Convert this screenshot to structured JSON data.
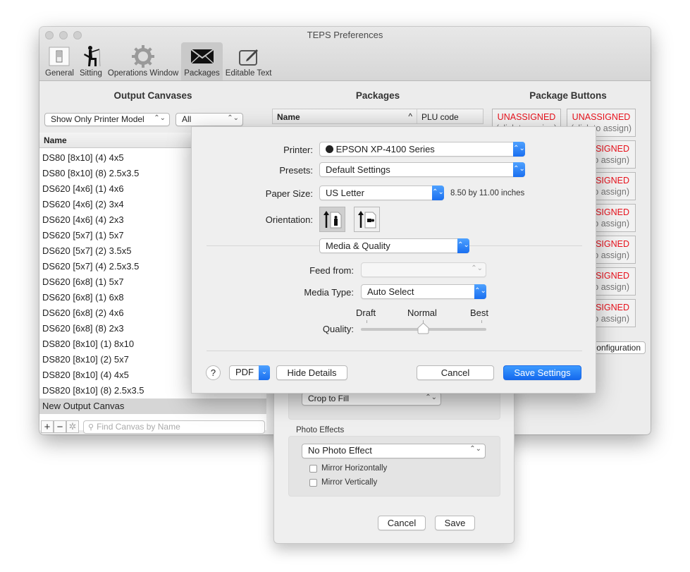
{
  "window": {
    "title": "TEPS Preferences",
    "toolbar": [
      {
        "label": "General",
        "icon": "switch-icon"
      },
      {
        "label": "Sitting",
        "icon": "fishing-person-icon"
      },
      {
        "label": "Operations Window",
        "icon": "gear-icon"
      },
      {
        "label": "Packages",
        "icon": "envelope-icon",
        "active": true
      },
      {
        "label": "Editable Text",
        "icon": "edit-pencil-icon"
      }
    ]
  },
  "output_canvases": {
    "title": "Output Canvases",
    "filter_popup": "Show Only Printer Model",
    "model_popup": "All",
    "column_header": "Name",
    "items": [
      "DS80 [8x10] (4) 4x5",
      "DS80 [8x10] (8) 2.5x3.5",
      "DS620 [4x6] (1) 4x6",
      "DS620 [4x6] (2) 3x4",
      "DS620 [4x6] (4) 2x3",
      "DS620 [5x7] (1) 5x7",
      "DS620 [5x7] (2) 3.5x5",
      "DS620 [5x7] (4) 2.5x3.5",
      "DS620 [6x8] (1) 5x7",
      "DS620 [6x8] (1) 6x8",
      "DS620 [6x8] (2) 4x6",
      "DS620 [6x8] (8) 2x3",
      "DS820 [8x10] (1) 8x10",
      "DS820 [8x10] (2) 5x7",
      "DS820 [8x10] (4) 4x5",
      "DS820 [8x10] (8) 2.5x3.5"
    ],
    "selected_item": "New Output Canvas",
    "add_label": "+",
    "remove_label": "−",
    "search_placeholder": "Find Canvas by Name"
  },
  "packages": {
    "title": "Packages",
    "columns": [
      "Name",
      "PLU code"
    ],
    "sort_indicator": "^"
  },
  "package_buttons": {
    "title": "Package Buttons",
    "first_row": [
      {
        "title": "UNASSIGNED",
        "subtitle": "(click to assign)"
      },
      {
        "title": "UNASSIGNED",
        "subtitle": "(click to assign)"
      }
    ],
    "partial_rows": [
      {
        "title": "SSIGNED",
        "subtitle": "to assign)"
      },
      {
        "title": "SSIGNED",
        "subtitle": "to assign)"
      },
      {
        "title": "SSIGNED",
        "subtitle": "to assign)"
      },
      {
        "title": "SSIGNED",
        "subtitle": "to assign)"
      },
      {
        "title": "SSIGNED",
        "subtitle": "to assign)"
      },
      {
        "title": "SSIGNED",
        "subtitle": "to assign)"
      }
    ],
    "config_button": "onfiguration",
    "accent": "#e8121c"
  },
  "print_dialog": {
    "printer_label": "Printer:",
    "printer_value": "EPSON XP-4100 Series",
    "presets_label": "Presets:",
    "presets_value": "Default Settings",
    "paper_label": "Paper Size:",
    "paper_value": "US Letter",
    "paper_dims": "8.50 by 11.00 inches",
    "orientation_label": "Orientation:",
    "orientation_selected": "portrait",
    "section_value": "Media & Quality",
    "feed_label": "Feed from:",
    "feed_value": "",
    "media_label": "Media Type:",
    "media_value": "Auto Select",
    "quality_label": "Quality:",
    "quality_ticks": [
      "Draft",
      "Normal",
      "Best"
    ],
    "quality_value": "Normal",
    "help_label": "?",
    "pdf_label": "PDF",
    "hide_details_label": "Hide Details",
    "cancel_label": "Cancel",
    "save_label": "Save Settings",
    "primary_color": "#1a6ff0"
  },
  "sheet": {
    "crop_value": "Crop to Fill",
    "photo_effects_title": "Photo Effects",
    "photo_effect_value": "No Photo Effect",
    "mirror_h_label": "Mirror Horizontally",
    "mirror_v_label": "Mirror Vertically",
    "mirror_h_checked": false,
    "mirror_v_checked": false,
    "cancel_label": "Cancel",
    "save_label": "Save"
  }
}
